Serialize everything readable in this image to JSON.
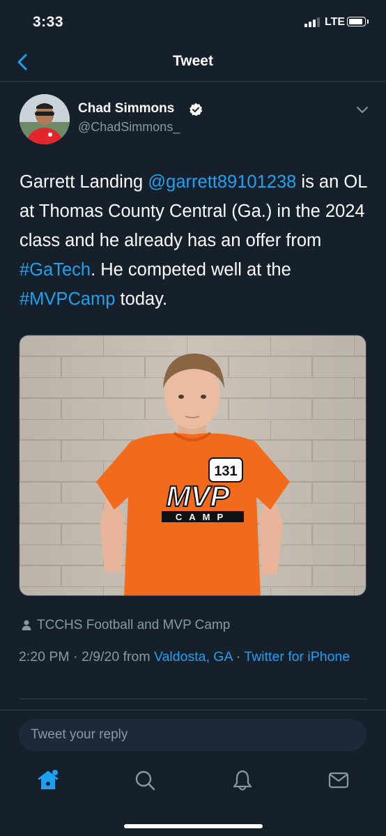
{
  "status_bar": {
    "time": "3:33",
    "network": "LTE"
  },
  "nav": {
    "title": "Tweet",
    "back_icon": "chevron-left-icon"
  },
  "tweet": {
    "author_name": "Chad Simmons",
    "author_handle": "@ChadSimmons_",
    "verified": true,
    "text_parts": {
      "p1": "Garrett Landing ",
      "mention": "@garrett89101238",
      "p2": " is an OL at Thomas County Central (Ga.) in the 2024 class and he already has an offer from ",
      "hashtag1": "#GaTech",
      "p3": ". He competed well at the ",
      "hashtag2": "#MVPCamp",
      "p4": " today."
    },
    "shirt_logo": {
      "number": "131",
      "word": "MVP",
      "sub": "CAMP"
    },
    "tagged_people": "TCCHS Football and MVP Camp",
    "meta": {
      "time": "2:20 PM",
      "sep1": " · ",
      "date": "2/9/20",
      "from": " from ",
      "location": "Valdosta, GA",
      "sep2": " · ",
      "client": "Twitter for iPhone"
    }
  },
  "reply": {
    "placeholder": "Tweet your reply"
  },
  "tab_bar": {
    "items": [
      "home-icon",
      "search-icon",
      "notifications-bell-icon",
      "messages-envelope-icon"
    ]
  },
  "colors": {
    "background": "#15202b",
    "accent": "#1da1f2",
    "secondary_text": "#8899a6",
    "shirt_orange": "#f26b1d"
  }
}
